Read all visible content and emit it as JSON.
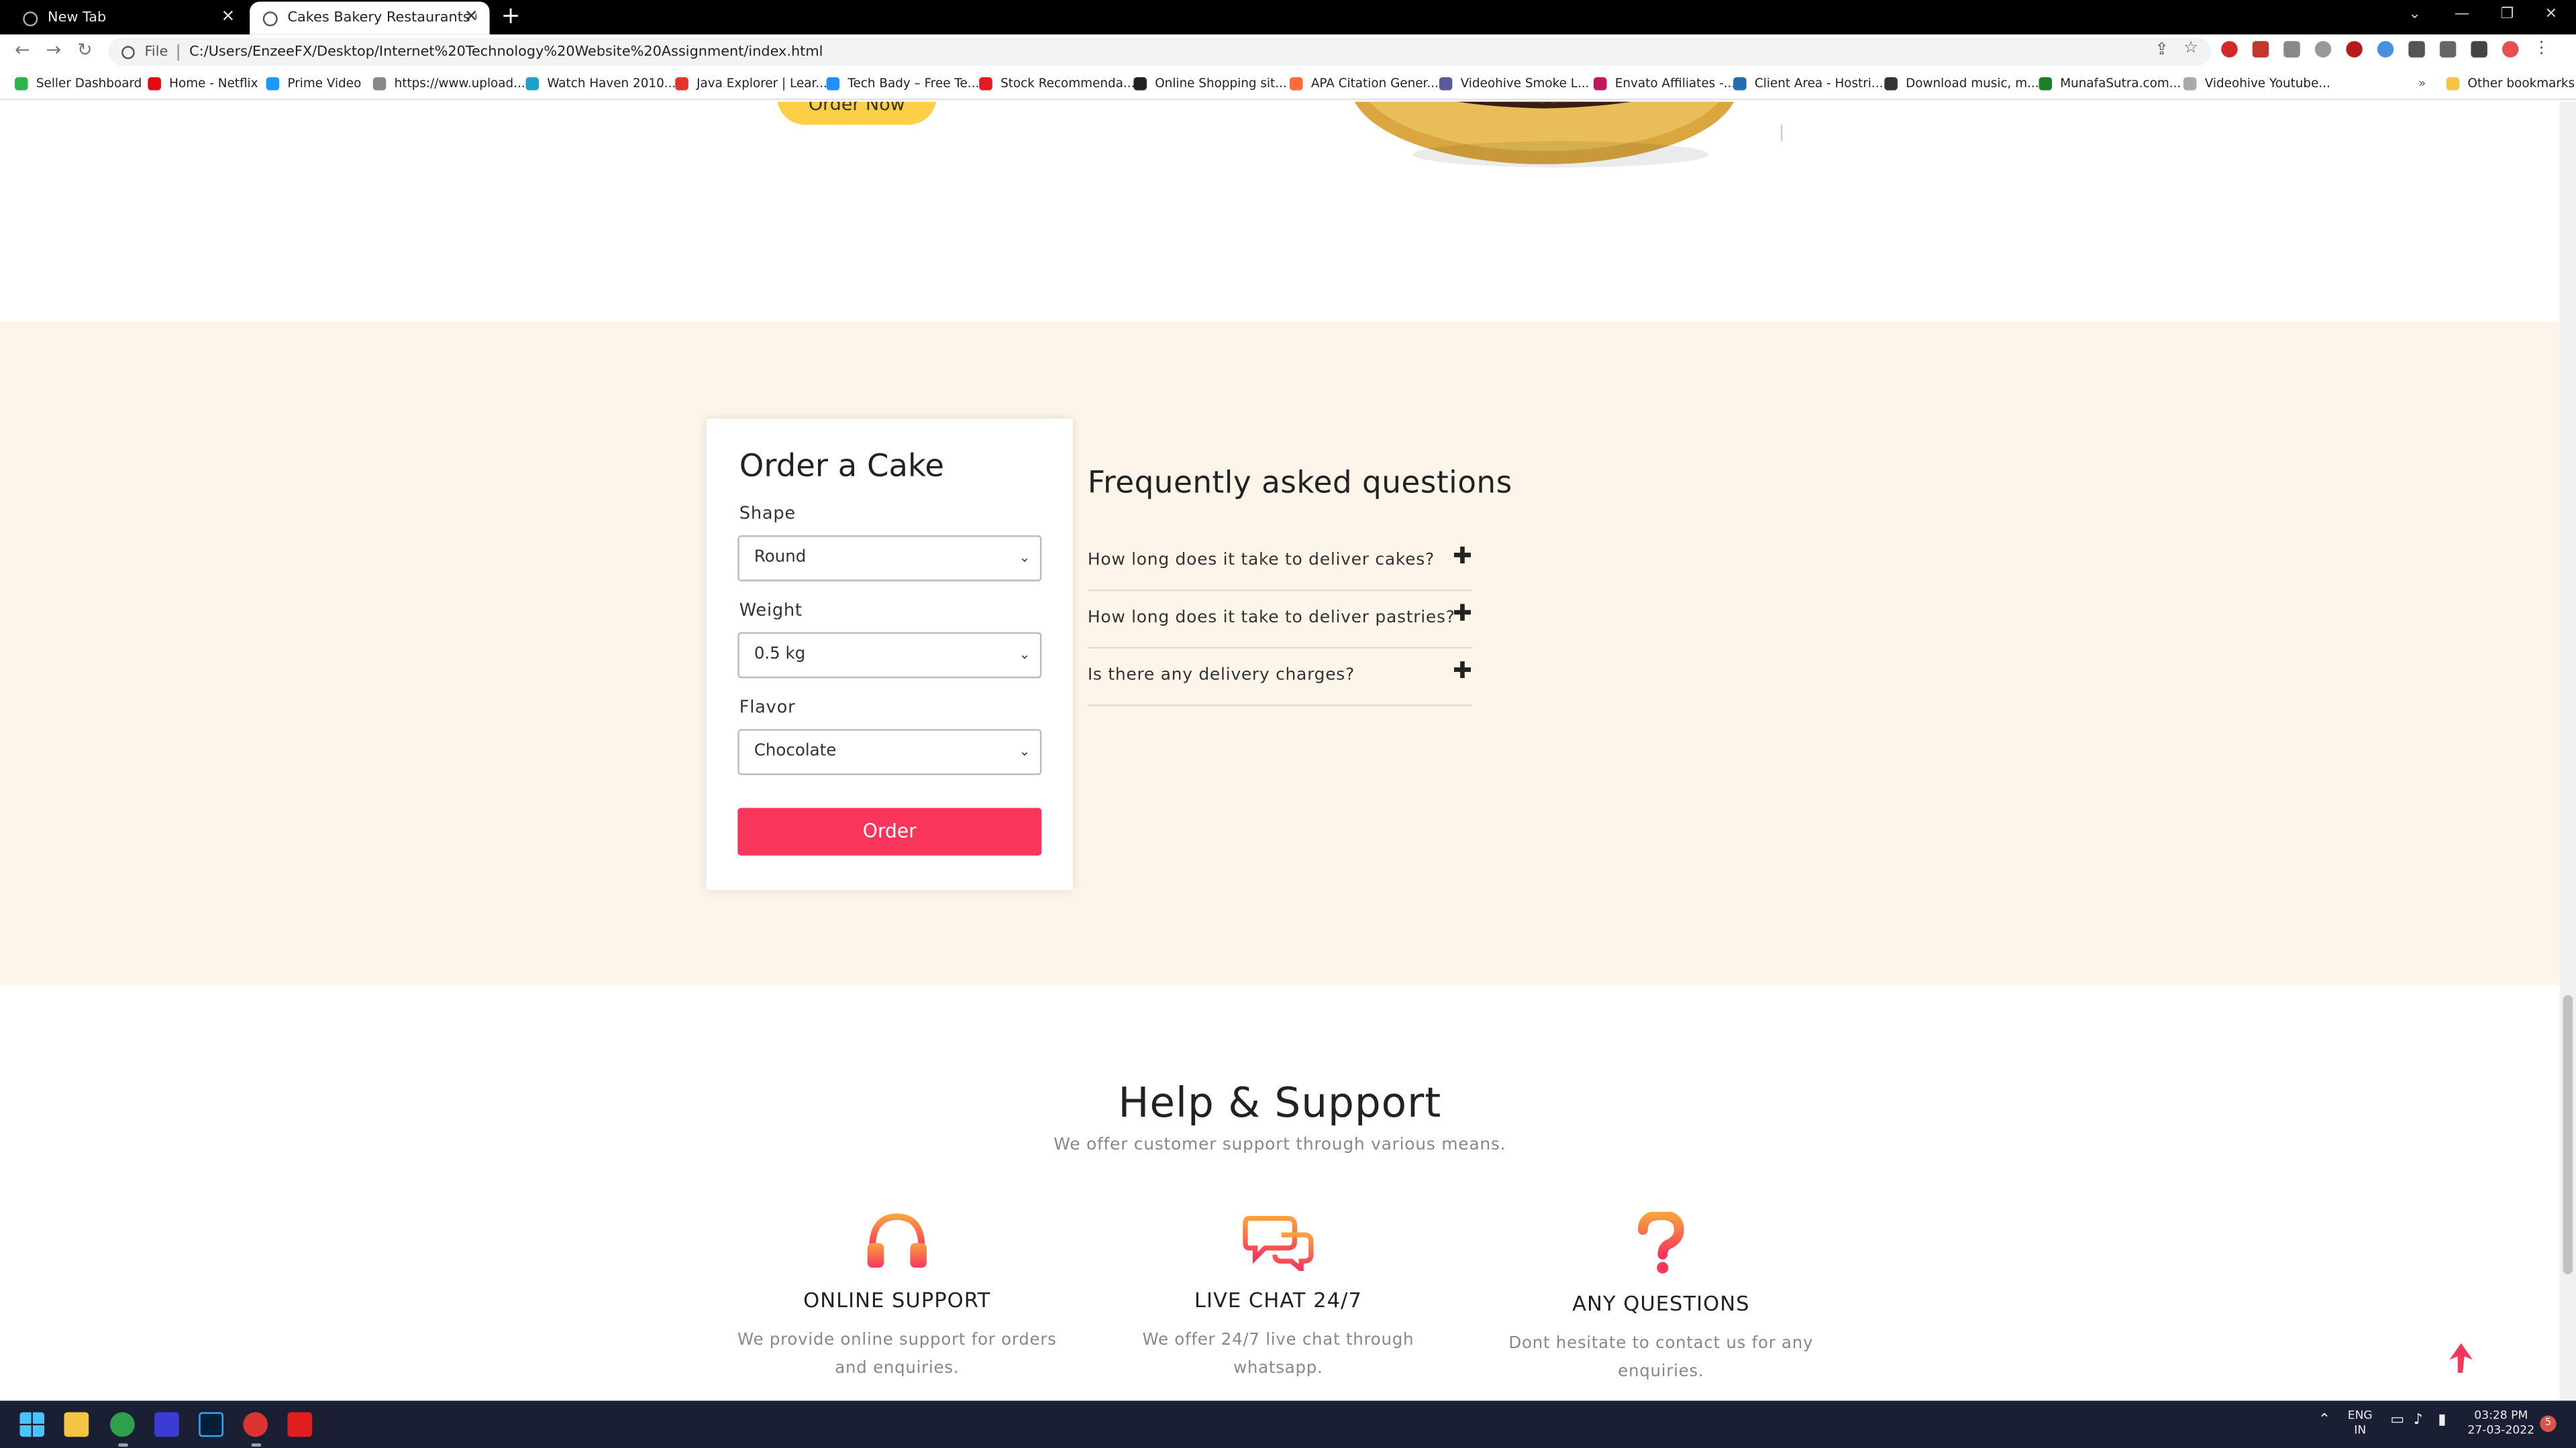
{
  "browser": {
    "tabs": [
      {
        "label": "New Tab",
        "active": false
      },
      {
        "label": "Cakes Bakery Restaurants Categ...",
        "active": true
      }
    ],
    "new_tab_glyph": "+",
    "address": {
      "scheme_label": "File",
      "url": "C:/Users/EnzeeFX/Desktop/Internet%20Technology%20Website%20Assignment/index.html"
    },
    "bookmarks": [
      {
        "label": "Seller Dashboard",
        "color": "#2db34a"
      },
      {
        "label": "Home - Netflix",
        "color": "#e50914"
      },
      {
        "label": "Prime Video",
        "color": "#1a98ff"
      },
      {
        "label": "https://www.upload...",
        "color": "#888888"
      },
      {
        "label": "Watch Haven 2010...",
        "color": "#1aa3c8"
      },
      {
        "label": "Java Explorer | Lear...",
        "color": "#e3342f"
      },
      {
        "label": "Tech Bady – Free Te...",
        "color": "#1e90ff"
      },
      {
        "label": "Stock Recommenda...",
        "color": "#e31b23"
      },
      {
        "label": "Online Shopping sit...",
        "color": "#222222"
      },
      {
        "label": "APA Citation Gener...",
        "color": "#ff6a3d"
      },
      {
        "label": "Videohive Smoke L...",
        "color": "#5a5a9a"
      },
      {
        "label": "Envato Affiliates -...",
        "color": "#c2185b"
      },
      {
        "label": "Client Area - Hostri...",
        "color": "#1f6fb2"
      },
      {
        "label": "Download music, m...",
        "color": "#333333"
      },
      {
        "label": "MunafaSutra.com...",
        "color": "#1b7f2a"
      },
      {
        "label": "Videohive Youtube...",
        "color": "#aaaaaa"
      }
    ],
    "other_bookmarks": "Other bookmarks"
  },
  "page": {
    "hero": {
      "order_now_label": "Order Now"
    },
    "order_form": {
      "title": "Order a Cake",
      "shape_label": "Shape",
      "shape_value": "Round",
      "weight_label": "Weight",
      "weight_value": "0.5 kg",
      "flavor_label": "Flavor",
      "flavor_value": "Chocolate",
      "submit_label": "Order"
    },
    "faq": {
      "title": "Frequently asked questions",
      "items": [
        {
          "question": "How long does it take to deliver cakes?"
        },
        {
          "question": "How long does it take to deliver pastries?"
        },
        {
          "question": "Is there any delivery charges?"
        }
      ]
    },
    "help": {
      "title": "Help & Support",
      "subtitle": "We offer customer support through various means.",
      "features": [
        {
          "icon": "headphones-icon",
          "title": "ONLINE SUPPORT",
          "desc": "We provide online support for orders and enquiries."
        },
        {
          "icon": "chat-bubbles-icon",
          "title": "LIVE CHAT 24/7",
          "desc": "We offer 24/7 live chat through whatsapp."
        },
        {
          "icon": "question-mark-icon",
          "title": "ANY QUESTIONS",
          "desc": "Dont hesitate to contact us for any enquiries."
        }
      ]
    }
  },
  "colors": {
    "accent_pink": "#f9355c",
    "order_now_yellow": "#fbd046",
    "beige_section": "#fdf5e9",
    "icon_gradient_top": "#f9a03f",
    "icon_gradient_bottom": "#f9355c"
  },
  "taskbar": {
    "language": "ENG",
    "region": "IN",
    "time": "03:28 PM",
    "date": "27-03-2022",
    "notification_count": "5"
  }
}
